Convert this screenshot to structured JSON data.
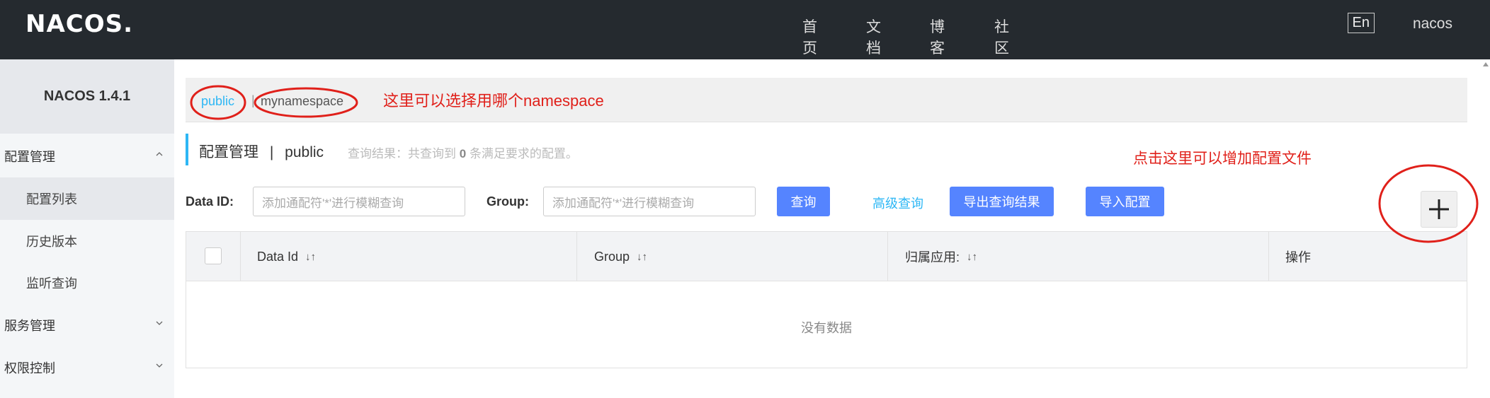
{
  "header": {
    "logo": "NACOS.",
    "nav": [
      "首页",
      "文档",
      "博客",
      "社区"
    ],
    "lang": "En",
    "user": "nacos"
  },
  "sidebar": {
    "version": "NACOS 1.4.1",
    "groups": [
      {
        "label": "配置管理",
        "expanded": true
      },
      {
        "label": "服务管理",
        "expanded": false
      },
      {
        "label": "权限控制",
        "expanded": false
      }
    ],
    "config_items": [
      "配置列表",
      "历史版本",
      "监听查询"
    ]
  },
  "namespace": {
    "public": "public",
    "separator": "|",
    "mynamespace": "mynamespace"
  },
  "annotations": {
    "namespace_hint": "这里可以选择用哪个namespace",
    "add_hint": "点击这里可以增加配置文件"
  },
  "page": {
    "title_prefix": "配置管理",
    "title_sep": "|",
    "title_ns": "public",
    "result_prefix": "查询结果：共查询到",
    "result_count": "0",
    "result_suffix": "条满足要求的配置。"
  },
  "search": {
    "data_id_label": "Data ID:",
    "data_id_placeholder": "添加通配符'*'进行模糊查询",
    "group_label": "Group:",
    "group_placeholder": "添加通配符'*'进行模糊查询",
    "query_button": "查询",
    "advanced_link": "高级查询",
    "export_button": "导出查询结果",
    "import_button": "导入配置"
  },
  "table": {
    "columns": [
      "Data Id",
      "Group",
      "归属应用:",
      "操作"
    ],
    "empty_text": "没有数据"
  },
  "colors": {
    "header_bg": "#252a2f",
    "primary": "#5584ff",
    "accent": "#2db7f5",
    "annotation": "#e0201a"
  }
}
